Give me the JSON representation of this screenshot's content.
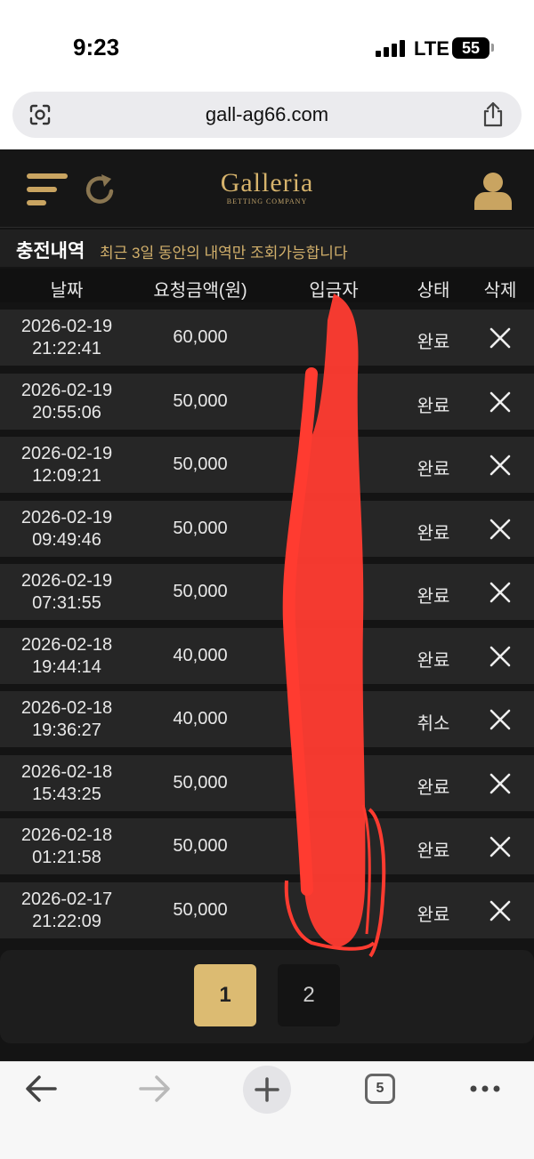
{
  "status_bar": {
    "time": "9:23",
    "network": "LTE",
    "battery": "55"
  },
  "browser": {
    "url": "gall-ag66.com",
    "tab_count": "5"
  },
  "header": {
    "logo": "Galleria",
    "logo_sub": "BETTING COMPANY"
  },
  "page": {
    "title": "충전내역",
    "note": "최근 3일 동안의 내역만 조회가능합니다"
  },
  "table": {
    "columns": [
      "날짜",
      "요청금액(원)",
      "입금자",
      "상태",
      "삭제"
    ],
    "rows": [
      {
        "date": "2026-02-19",
        "time": "21:22:41",
        "amount": "60,000",
        "status": "완료"
      },
      {
        "date": "2026-02-19",
        "time": "20:55:06",
        "amount": "50,000",
        "status": "완료"
      },
      {
        "date": "2026-02-19",
        "time": "12:09:21",
        "amount": "50,000",
        "status": "완료"
      },
      {
        "date": "2026-02-19",
        "time": "09:49:46",
        "amount": "50,000",
        "status": "완료"
      },
      {
        "date": "2026-02-19",
        "time": "07:31:55",
        "amount": "50,000",
        "status": "완료"
      },
      {
        "date": "2026-02-18",
        "time": "19:44:14",
        "amount": "40,000",
        "status": "완료"
      },
      {
        "date": "2026-02-18",
        "time": "19:36:27",
        "amount": "40,000",
        "status": "취소"
      },
      {
        "date": "2026-02-18",
        "time": "15:43:25",
        "amount": "50,000",
        "status": "완료"
      },
      {
        "date": "2026-02-18",
        "time": "01:21:58",
        "amount": "50,000",
        "status": "완료"
      },
      {
        "date": "2026-02-17",
        "time": "21:22:09",
        "amount": "50,000",
        "status": "완료"
      }
    ]
  },
  "pagination": {
    "pages": [
      "1",
      "2"
    ],
    "current": "1"
  },
  "colors": {
    "accent": "#d6b36c",
    "background": "#141414",
    "row": "#262626",
    "redaction": "#ff3b30"
  }
}
